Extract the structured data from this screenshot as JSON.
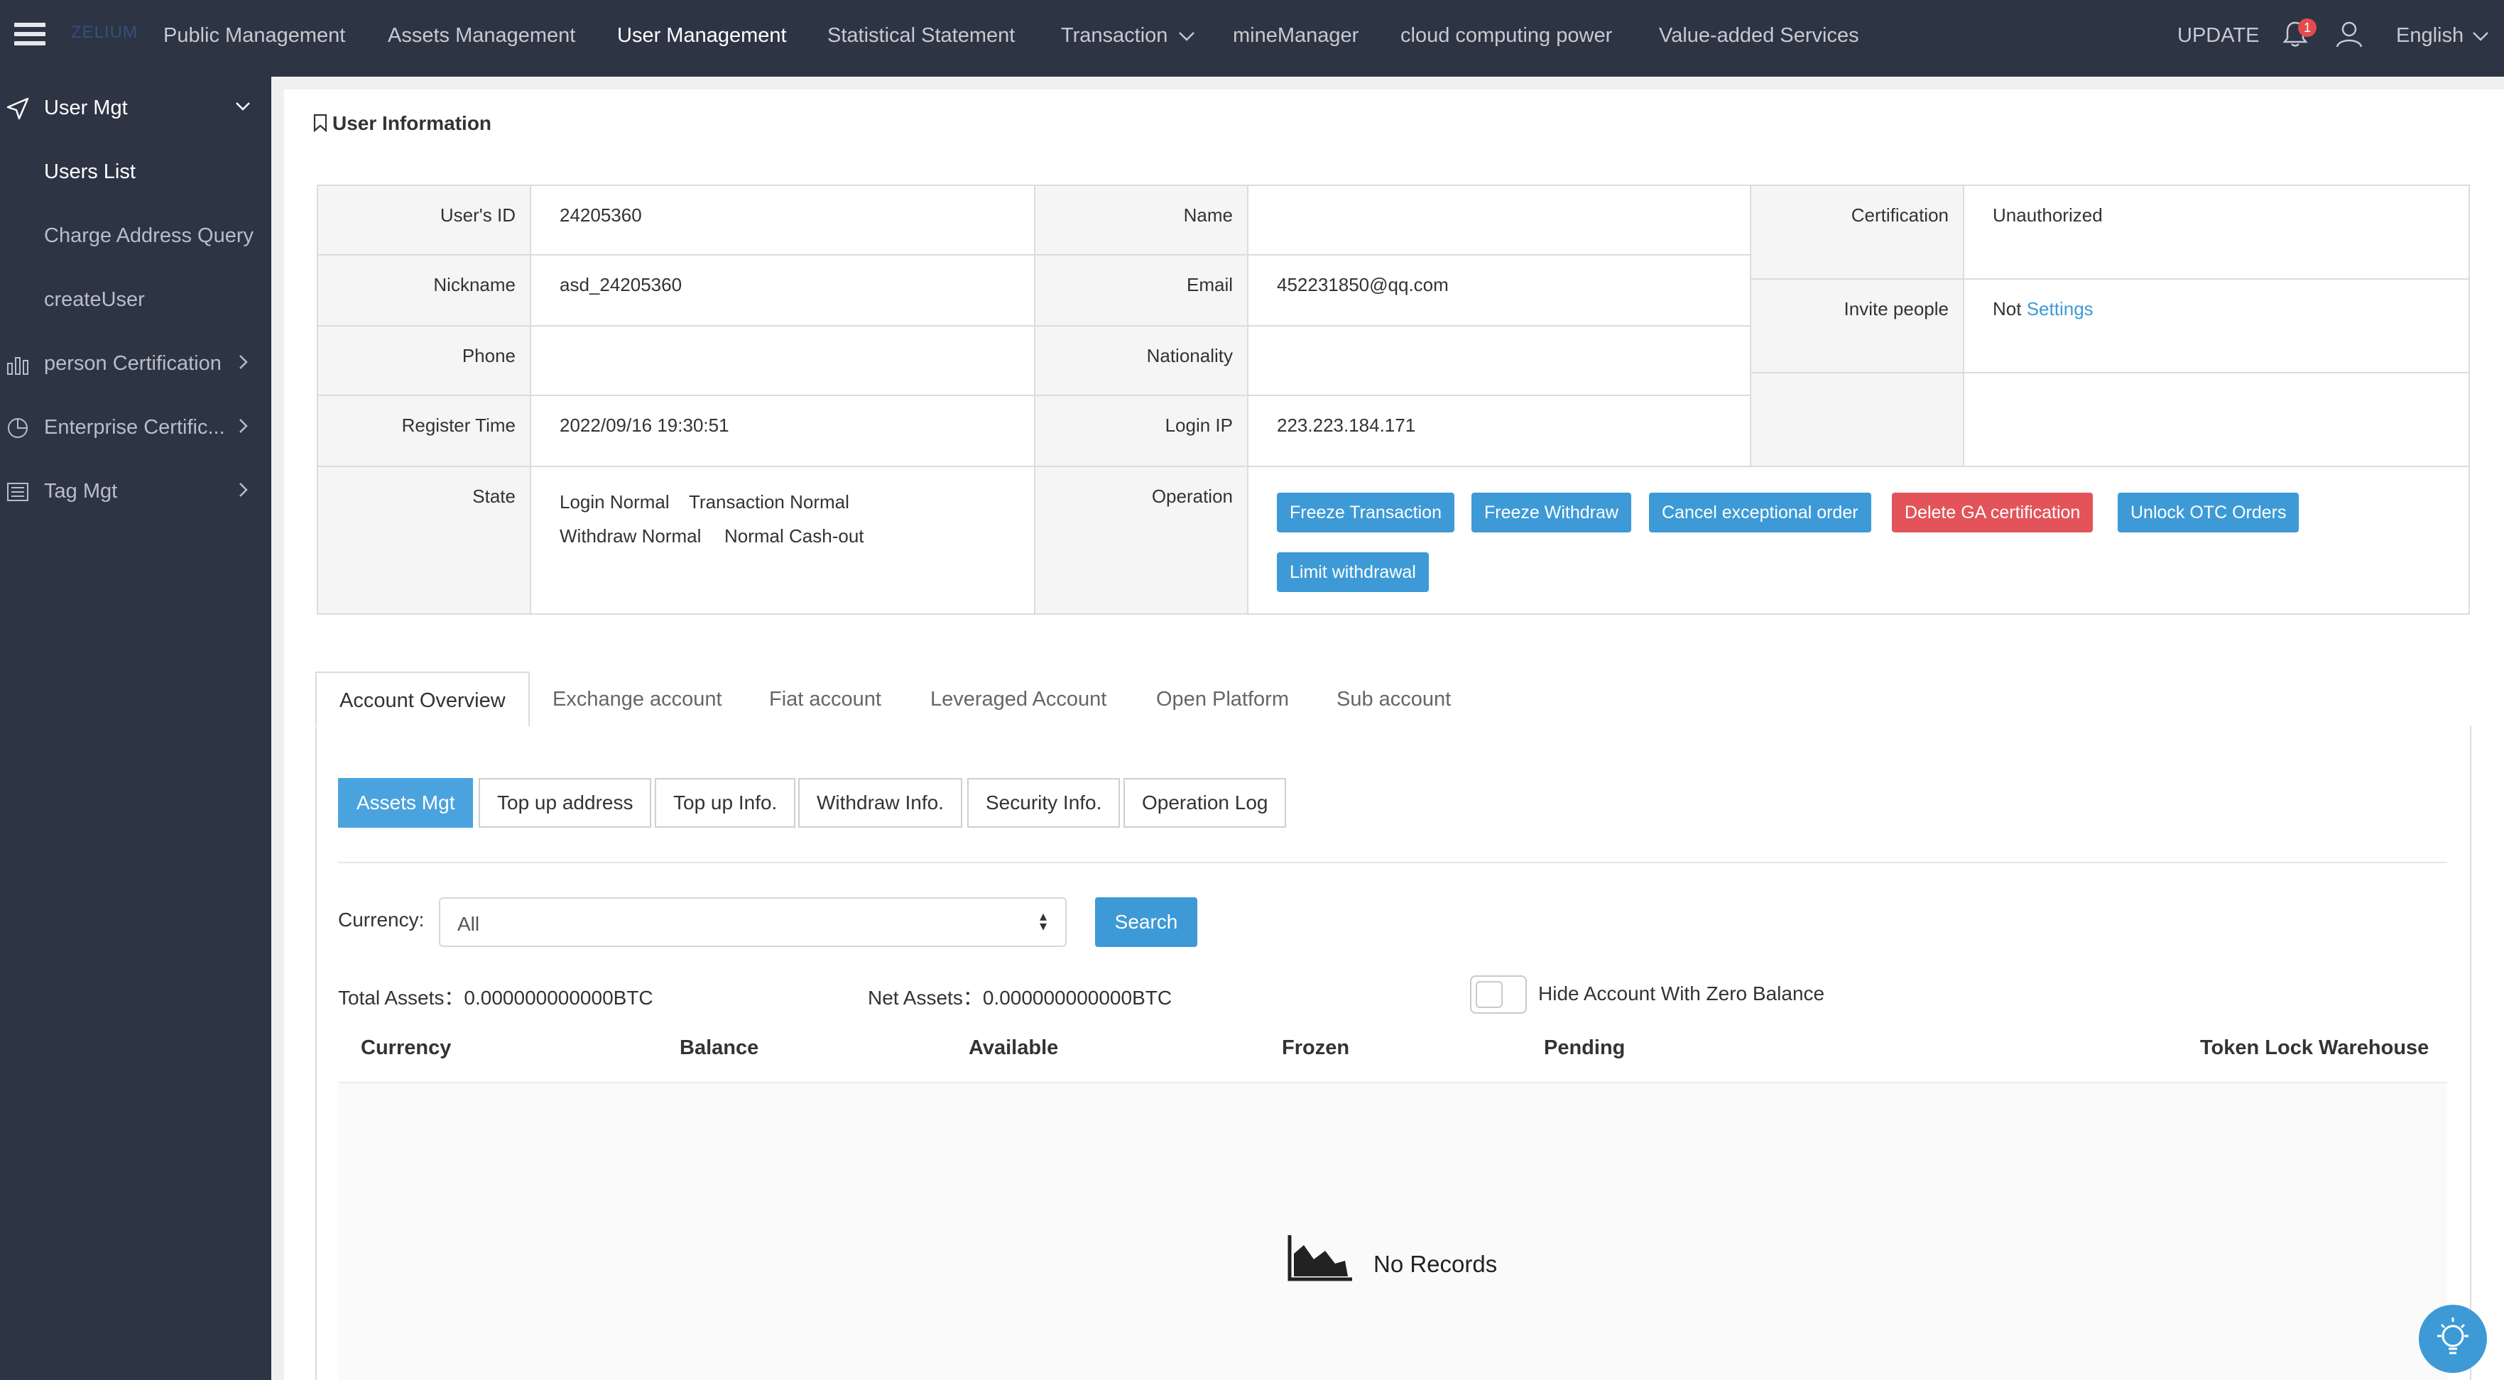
{
  "topbar": {
    "logo": "ZELIUM",
    "nav": [
      "Public Management",
      "Assets Management",
      "User Management",
      "Statistical Statement",
      "Transaction",
      "mineManager",
      "cloud computing power",
      "Value-added Services"
    ],
    "update": "UPDATE",
    "notif_count": "1",
    "language": "English"
  },
  "sidebar": {
    "user_mgt": "User Mgt",
    "users_list": "Users List",
    "charge_address": "Charge Address Query",
    "create_user": "createUser",
    "person_cert": "person Certification",
    "enterprise_cert": "Enterprise Certific...",
    "tag_mgt": "Tag Mgt"
  },
  "panel": {
    "title": "User Information"
  },
  "info": {
    "user_id_label": "User's ID",
    "user_id": "24205360",
    "name_label": "Name",
    "name": "",
    "cert_label": "Certification",
    "cert": "Unauthorized",
    "nickname_label": "Nickname",
    "nickname": "asd_24205360",
    "email_label": "Email",
    "email": "452231850@qq.com",
    "invite_label": "Invite people",
    "invite_not": "Not",
    "invite_settings": "Settings",
    "phone_label": "Phone",
    "phone": "",
    "nationality_label": "Nationality",
    "nationality": "",
    "register_label": "Register Time",
    "register": "2022/09/16 19:30:51",
    "login_ip_label": "Login IP",
    "login_ip": "223.223.184.171",
    "state_label": "State",
    "states": [
      "Login Normal",
      "Transaction Normal",
      "Withdraw Normal",
      "Normal Cash-out"
    ],
    "operation_label": "Operation",
    "operations": [
      "Freeze Transaction",
      "Freeze Withdraw",
      "Cancel exceptional order",
      "Delete GA certification",
      "Unlock OTC Orders",
      "Limit withdrawal"
    ]
  },
  "tabs": [
    "Account Overview",
    "Exchange account",
    "Fiat account",
    "Leveraged Account",
    "Open Platform",
    "Sub account"
  ],
  "subtabs": [
    "Assets Mgt",
    "Top up address",
    "Top up Info.",
    "Withdraw Info.",
    "Security Info.",
    "Operation Log"
  ],
  "filter": {
    "currency_label": "Currency:",
    "currency_value": "All",
    "search": "Search"
  },
  "summary": {
    "total_label": "Total Assets：",
    "total_value": "0.000000000000BTC",
    "net_label": "Net Assets：",
    "net_value": "0.000000000000BTC",
    "hide_zero": "Hide Account With Zero Balance",
    "hide_zero_on": false
  },
  "table": {
    "columns": [
      "Currency",
      "Balance",
      "Available",
      "Frozen",
      "Pending",
      "Token Lock Warehouse"
    ],
    "empty": "No Records"
  },
  "colors": {
    "topbar": "#2d3444",
    "accent": "#3d9ad6",
    "danger": "#e2545a"
  }
}
